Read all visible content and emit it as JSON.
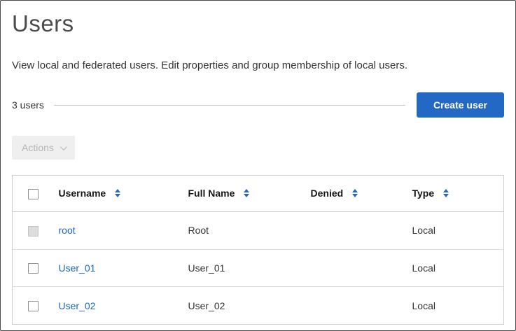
{
  "page": {
    "title": "Users",
    "description": "View local and federated users. Edit properties and group membership of local users.",
    "user_count": "3 users"
  },
  "toolbar": {
    "create_user_label": "Create user",
    "actions_label": "Actions"
  },
  "table": {
    "columns": [
      "Username",
      "Full Name",
      "Denied",
      "Type"
    ],
    "rows": [
      {
        "username": "root",
        "full_name": "Root",
        "denied": "",
        "type": "Local"
      },
      {
        "username": "User_01",
        "full_name": "User_01",
        "denied": "",
        "type": "Local"
      },
      {
        "username": "User_02",
        "full_name": "User_02",
        "denied": "",
        "type": "Local"
      }
    ]
  },
  "colors": {
    "accent_blue": "#2368c4",
    "link_blue": "#1a66c2"
  }
}
